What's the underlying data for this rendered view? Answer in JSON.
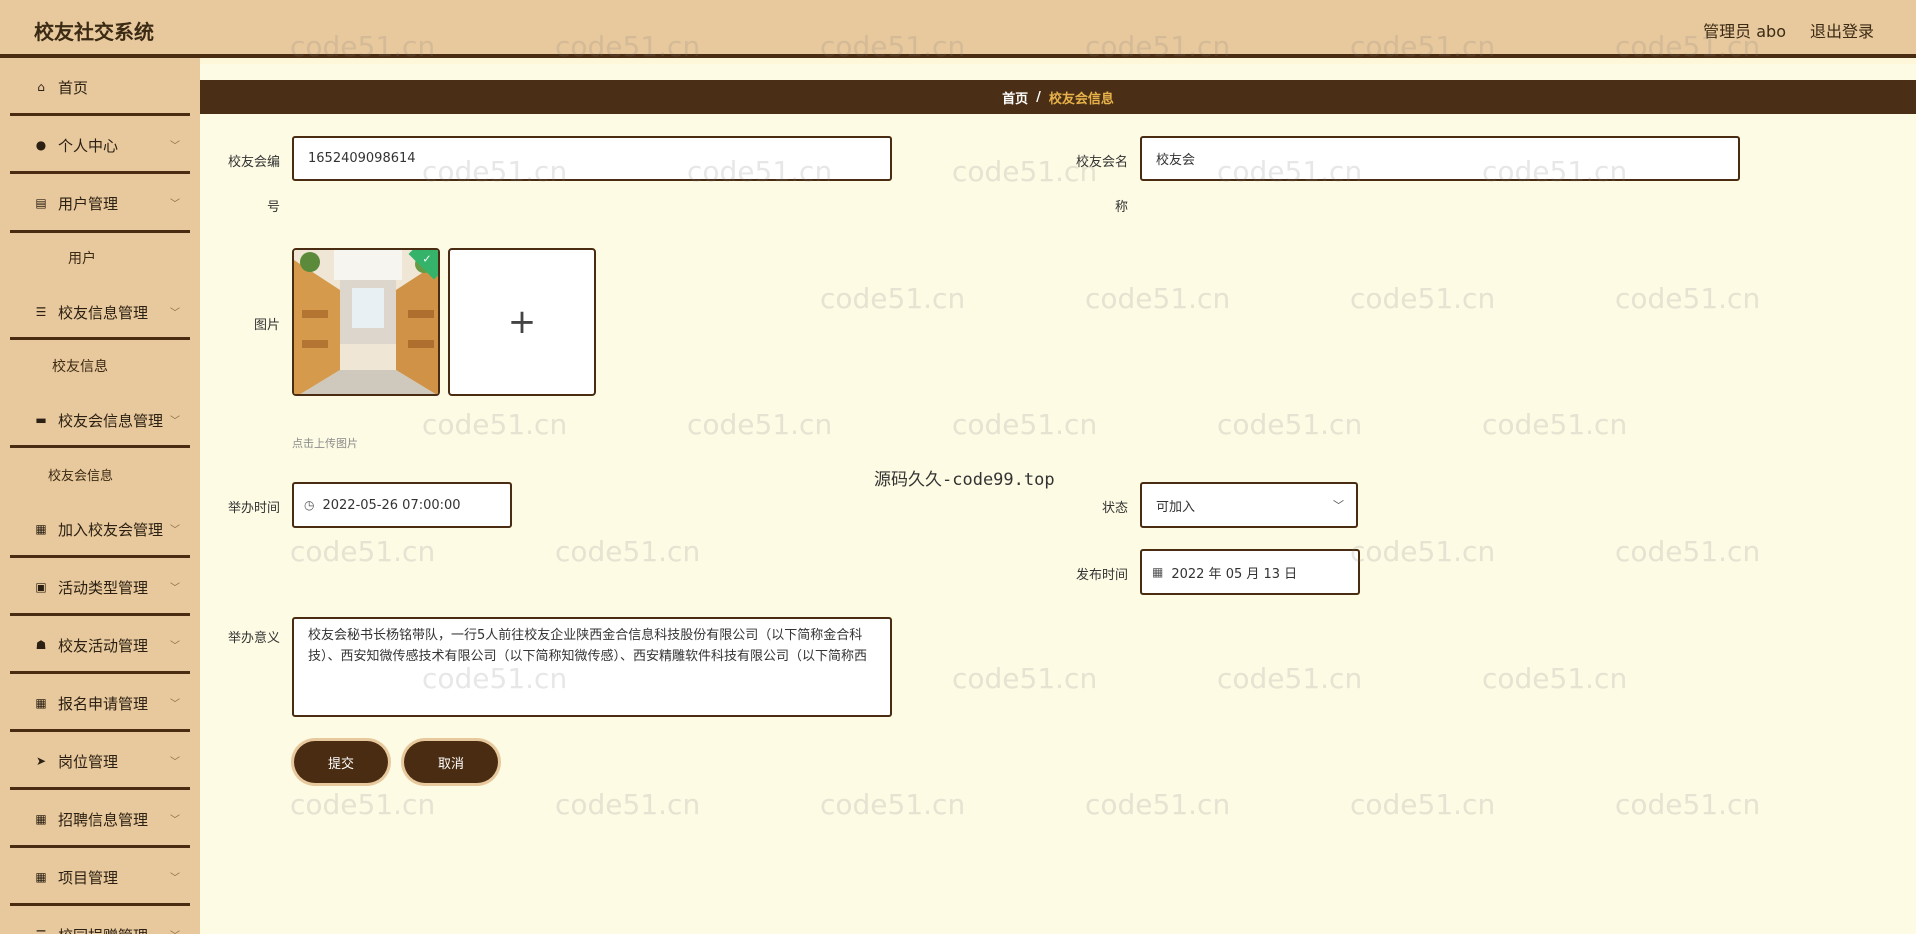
{
  "header": {
    "app_title": "校友社交系统",
    "user_label": "管理员 abo",
    "logout_label": "退出登录"
  },
  "sidebar": {
    "items": [
      {
        "label": "首页",
        "icon": "home-icon"
      },
      {
        "label": "个人中心",
        "icon": "user-icon"
      },
      {
        "label": "用户管理",
        "icon": "chart-icon"
      },
      {
        "label": "用户",
        "sub": true
      },
      {
        "label": "校友信息管理",
        "icon": "sliders-icon"
      },
      {
        "label": "校友信息",
        "sub": true
      },
      {
        "label": "校友会信息管理",
        "icon": "briefcase-icon"
      },
      {
        "label": "校友会信息",
        "sub": true
      },
      {
        "label": "加入校友会管理",
        "icon": "grid-icon"
      },
      {
        "label": "活动类型管理",
        "icon": "clipboard-icon"
      },
      {
        "label": "校友活动管理",
        "icon": "thumb-icon"
      },
      {
        "label": "报名申请管理",
        "icon": "grid-icon"
      },
      {
        "label": "岗位管理",
        "icon": "send-icon"
      },
      {
        "label": "招聘信息管理",
        "icon": "grid-icon"
      },
      {
        "label": "项目管理",
        "icon": "grid-icon"
      },
      {
        "label": "校园捐赠管理",
        "icon": "sliders-icon"
      }
    ]
  },
  "breadcrumb": {
    "home": "首页",
    "separator": "/",
    "current": "校友会信息"
  },
  "form": {
    "code_label_1": "校友会编",
    "code_label_2": "号",
    "code_value": "1652409098614",
    "name_label_1": "校友会名",
    "name_label_2": "称",
    "name_value": "校友会",
    "image_label": "图片",
    "upload_tip": "点击上传图片",
    "upload_plus": "+",
    "hold_time_label": "举办时间",
    "hold_time_value": "2022-05-26 07:00:00",
    "status_label": "状态",
    "status_value": "可加入",
    "publish_time_label": "发布时间",
    "publish_time_value": "2022 年 05 月 13 日",
    "meaning_label": "举办意义",
    "meaning_value": "校友会秘书长杨铭带队，一行5人前往校友企业陕西金合信息科技股份有限公司（以下简称金合科技）、西安知微传感技术有限公司（以下简称知微传感）、西安精雕软件科技有限公司（以下简称西",
    "submit_label": "提交",
    "cancel_label": "取消"
  },
  "overlay": {
    "center_text": "源码久久-code99.top",
    "watermark": "code51.cn"
  },
  "colors": {
    "header_bg": "#e8c99d",
    "accent_dark": "#4a2c12",
    "page_bg": "#fdfbe4",
    "breadcrumb_current": "#e8b24a",
    "upload_check": "#35b36a"
  }
}
